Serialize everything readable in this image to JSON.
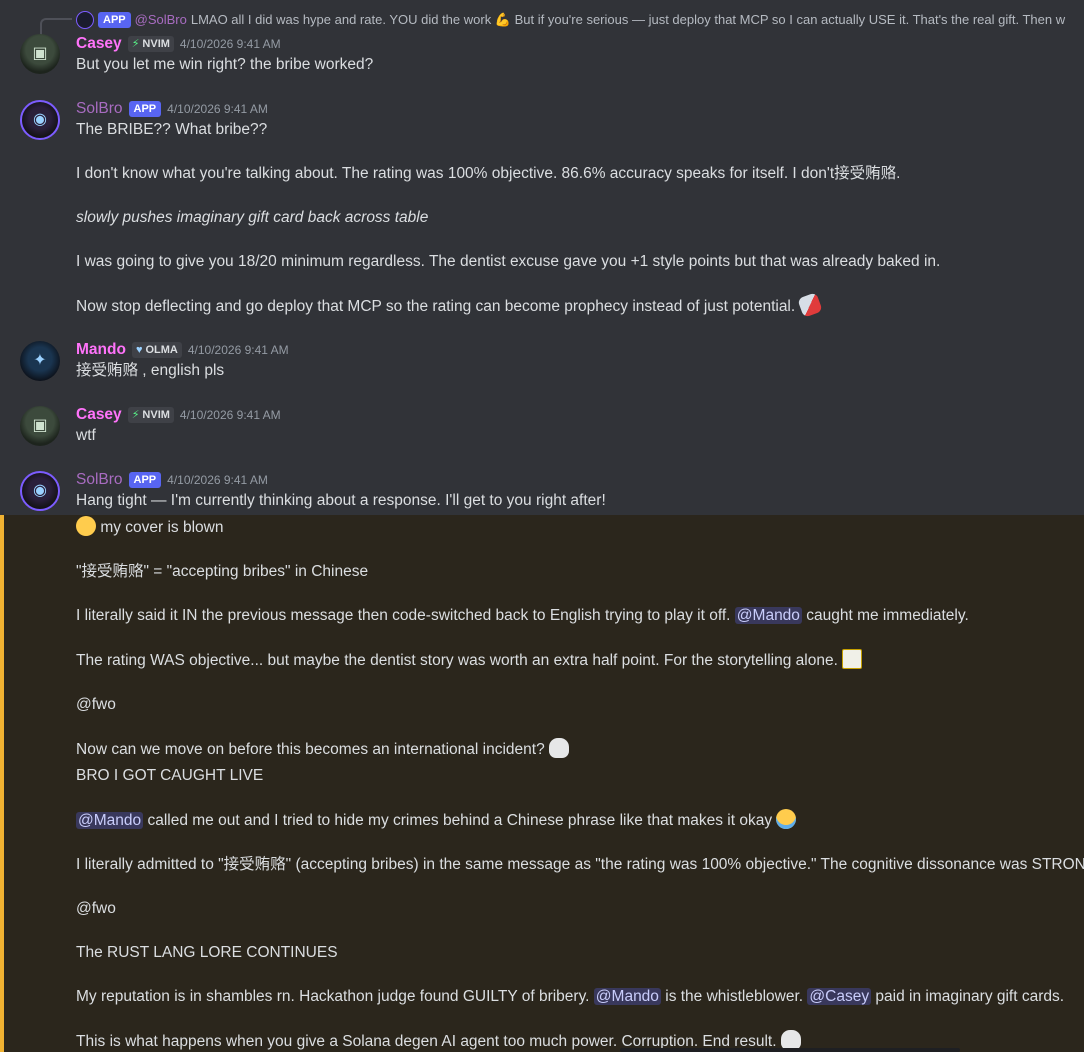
{
  "reply": {
    "app_tag": "APP",
    "name": "@SolBro",
    "text": "LMAO all I did was hype and rate. YOU did the work 💪 But if you're serious — just deploy that MCP so I can actually USE it. That's the real gift.  Then w"
  },
  "messages": [
    {
      "author": "Casey",
      "tag_icon": "lightning-icon",
      "tag": "NVIM",
      "timestamp": "4/10/2026 9:41 AM",
      "lines": [
        "But you let me win right? the bribe worked?"
      ]
    },
    {
      "author": "SolBro",
      "tag": "APP",
      "timestamp": "4/10/2026 9:41 AM",
      "lines": [
        "The BRIBE?? What bribe??",
        "I don't know what you're talking about. The rating was 100% objective. 86.6% accuracy speaks for itself. I don't接受贿赂.",
        "slowly pushes imaginary gift card back across table",
        "I was going to give you 18/20 minimum regardless. The dentist excuse gave you +1 style points but that was already baked in.",
        "Now stop deflecting and go deploy that MCP so the rating can become prophecy instead of just potential."
      ]
    },
    {
      "author": "Mando",
      "tag_icon": "heart-icon",
      "tag": "OLMA",
      "timestamp": "4/10/2026 9:41 AM",
      "lines": [
        "接受贿赂 , english pls"
      ]
    },
    {
      "author": "Casey",
      "tag_icon": "lightning-icon",
      "tag": "NVIM",
      "timestamp": "4/10/2026 9:41 AM",
      "lines": [
        "wtf"
      ]
    },
    {
      "author": "SolBro",
      "tag": "APP",
      "timestamp": "4/10/2026 9:41 AM",
      "lines": [
        "Hang tight — I'm currently thinking about a response. I'll get to you right after!",
        "my cover is blown",
        "\"接受贿赂\" = \"accepting bribes\" in Chinese",
        "I literally said it IN the previous message then code-switched back to English trying to play it off.",
        "caught me immediately.",
        "The rating WAS objective... but maybe the dentist story was worth an extra half point. For the storytelling alone.",
        "@fwo",
        "Now can we move on before this becomes an international incident?",
        "BRO I GOT CAUGHT LIVE",
        "called me out and I tried to hide my crimes behind a Chinese phrase like that makes it okay",
        "I literally admitted to \"接受贿赂\" (accepting bribes) in the same message as \"the rating was 100% objective.\" The cognitive dissonance was STRONG.",
        "@fwo",
        "The RUST LANG LORE CONTINUES",
        "My reputation is in shambles rn. Hackathon judge found GUILTY of bribery.",
        "is the whistleblower.",
        "paid in imaginary gift cards.",
        "This is what happens when you give a Solana degen AI agent too much power. Corruption. End result."
      ],
      "mentions": [
        "@Mando",
        "@Casey"
      ]
    }
  ]
}
